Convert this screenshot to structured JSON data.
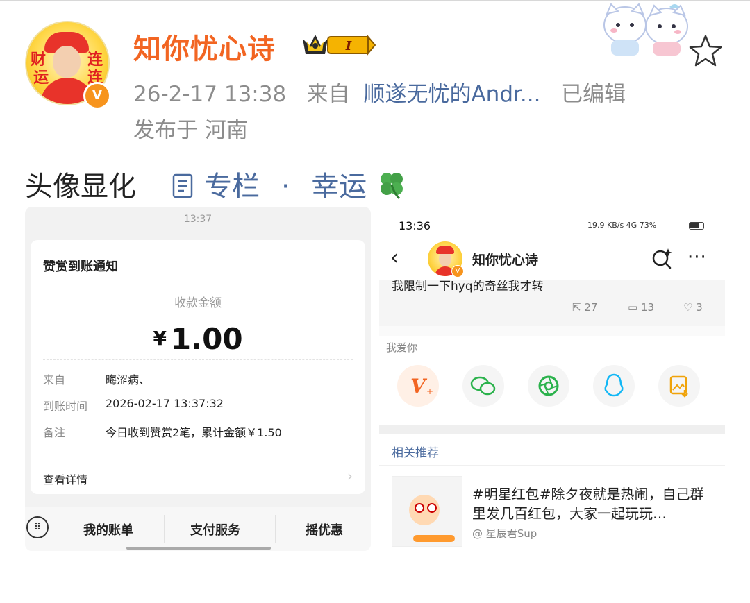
{
  "post": {
    "username": "知你忧心诗",
    "level_badge": "I",
    "date": "26-2-17 13:38",
    "from_label": "来自",
    "source": "顺遂无忧的Andr...",
    "edited": "已编辑",
    "location": "发布于 河南",
    "avatar_text": [
      "财",
      "运",
      "连",
      "连"
    ],
    "text_main": "头像显化",
    "link_column": "专栏",
    "separator": "·",
    "link_luck": "幸运",
    "clover": "🍀"
  },
  "left_shot": {
    "status_time": "13:37",
    "title": "赞赏到账通知",
    "amount_label": "收款金额",
    "currency": "¥",
    "amount": "1.00",
    "rows": [
      {
        "key": "来自",
        "value": "晦涩病、"
      },
      {
        "key": "到账时间",
        "value": "2026-02-17 13:37:32"
      },
      {
        "key": "备注",
        "value": "今日收到赞赏2笔，累计金额￥1.50"
      }
    ],
    "view_details": "查看详情",
    "bottom": {
      "bill": "我的账单",
      "pay": "支付服务",
      "discount": "摇优惠"
    }
  },
  "right_shot": {
    "status_time": "13:36",
    "status_right": "19.9 KB/s  4G  73%",
    "name": "知你忧心诗",
    "snippet": "我限制一下hyq的奇丝我才转",
    "reposts": "27",
    "comments": "13",
    "likes": "3",
    "share_label": "我爱你",
    "recommend_title": "相关推荐",
    "rec_text": "#明星红包#除夕夜就是热闹，自己群里发几百红包，大家一起玩玩…",
    "rec_author": "@ 星辰君Sup"
  },
  "colors": {
    "username": "#f26522",
    "link": "#4a6a9e",
    "meta": "#8c8c8c",
    "verified_badge": "#f7941d"
  },
  "icons": [
    "crown-badge-icon",
    "star-icon",
    "verified-icon",
    "column-icon",
    "clover-icon",
    "back-icon",
    "search-icon",
    "more-icon",
    "repost-icon",
    "comment-icon",
    "like-icon",
    "weibo-v-icon",
    "wechat-icon",
    "moments-icon",
    "qq-icon",
    "save-image-icon",
    "keyboard-icon"
  ]
}
